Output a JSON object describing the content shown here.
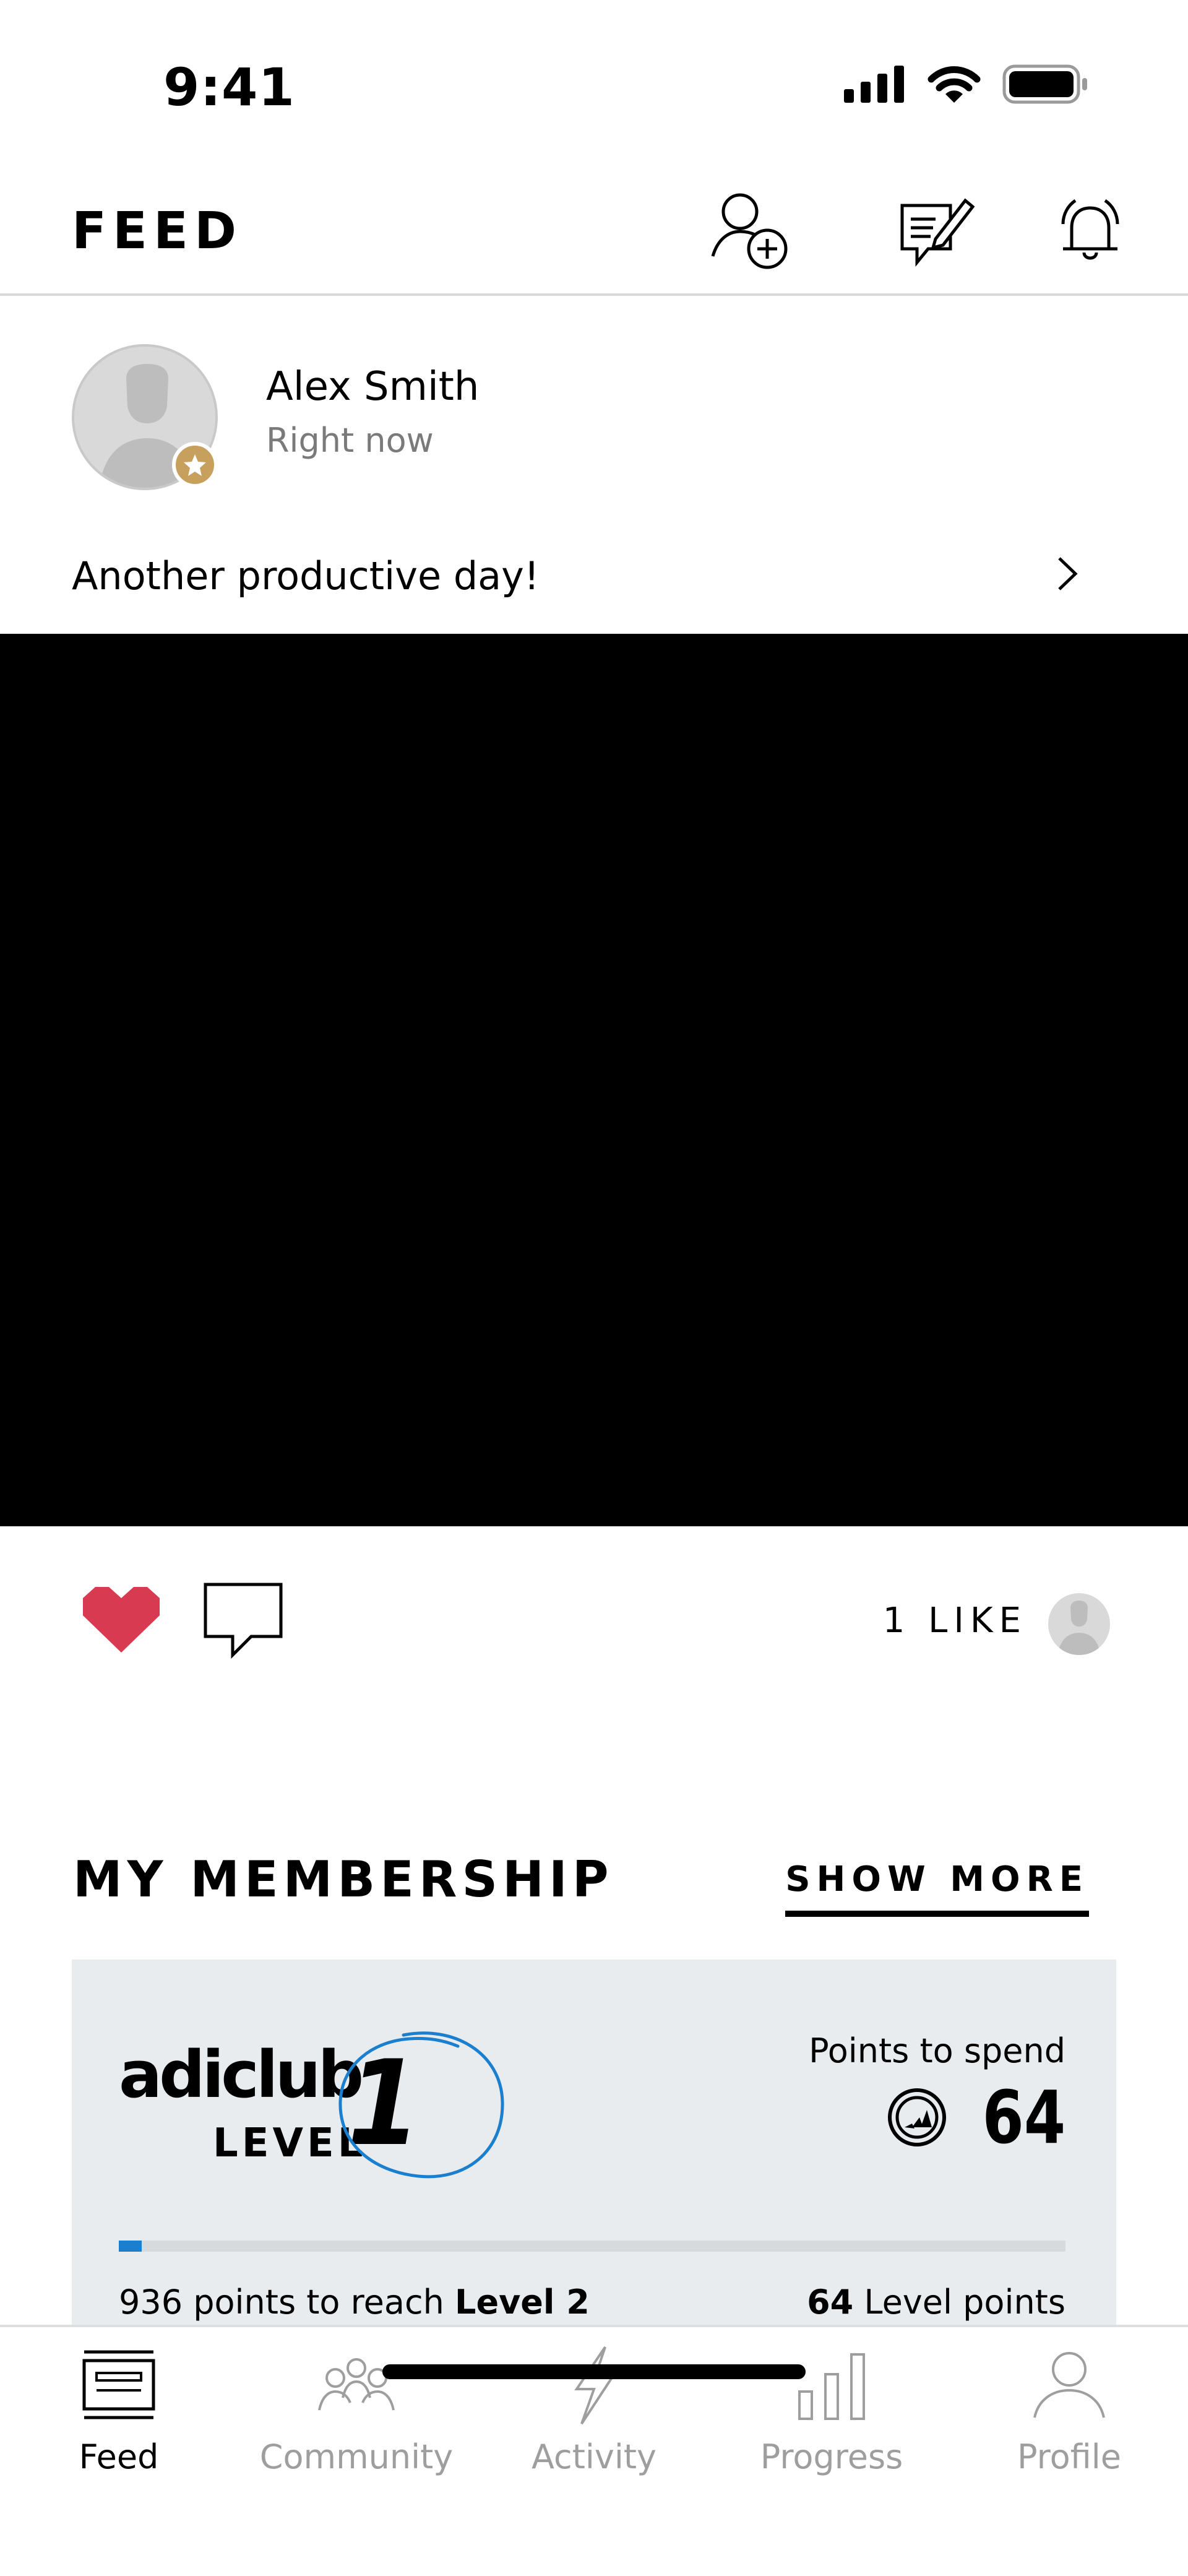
{
  "status_bar": {
    "time": "9:41",
    "icons": [
      "cellular-signal-icon",
      "wifi-icon",
      "battery-icon"
    ]
  },
  "header": {
    "title": "FEED",
    "actions": [
      "add-friend-icon",
      "compose-icon",
      "notifications-icon"
    ]
  },
  "post": {
    "user_name": "Alex Smith",
    "time": "Right now",
    "caption": "Another productive day!",
    "likes_label": "1 LIKE",
    "liked": true,
    "like_color": "#d83a52"
  },
  "membership": {
    "title": "MY MEMBERSHIP",
    "show_more": "SHOW MORE",
    "brand_word": "adiclub",
    "level_label": "LEVEL",
    "level_number": "1",
    "points_label": "Points to spend",
    "points_value": "64",
    "progress_fraction": 0.024,
    "reach_prefix": "936 points to reach ",
    "reach_level": "Level 2",
    "level_points_value": "64",
    "level_points_suffix": " Level points",
    "accent_color": "#1b7fd0",
    "card_bg": "#e9ecef"
  },
  "tab_bar": {
    "tabs": [
      {
        "label": "Feed",
        "icon": "feed-icon",
        "active": true
      },
      {
        "label": "Community",
        "icon": "community-icon",
        "active": false
      },
      {
        "label": "Activity",
        "icon": "activity-icon",
        "active": false
      },
      {
        "label": "Progress",
        "icon": "progress-icon",
        "active": false
      },
      {
        "label": "Profile",
        "icon": "profile-icon",
        "active": false
      }
    ]
  }
}
